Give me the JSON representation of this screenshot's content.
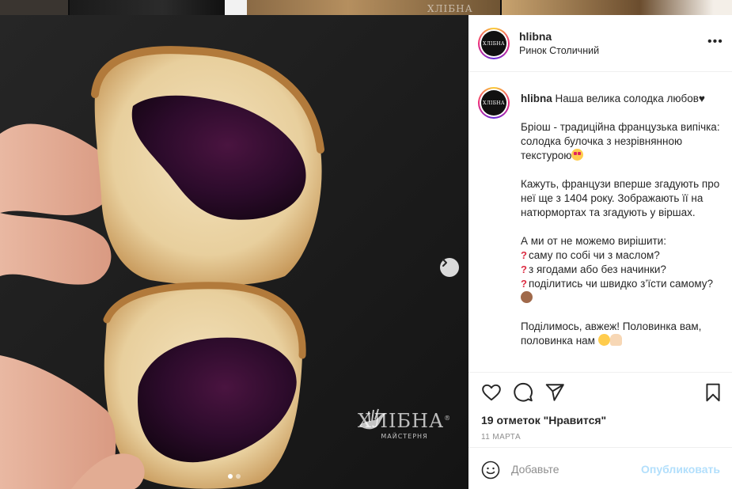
{
  "background": {
    "watermark": "ХЛІБНА"
  },
  "photo": {
    "brand_name": "ХЛІБНА",
    "brand_reg": "®",
    "brand_sub": "МАЙСТЕРНЯ",
    "carousel": {
      "slides": 2,
      "active_index": 0
    }
  },
  "post": {
    "avatar_text": "ХЛІБНА",
    "username": "hlibna",
    "location": "Ринок Столичний",
    "more_icon": "more-horizontal-icon",
    "caption": {
      "username": "hlibna",
      "title": "Наша велика солодка любов♥",
      "paragraphs": [
        "Бріош - традиційна французька випічка: солодка булочка з незрівнянною текстурою",
        "Кажуть, французи вперше згадують про неї ще з 1404 року. Зображають її на натюрмортах та згадують у віршах.",
        "А ми от не можемо вирішити:",
        "саму по собі чи з маслом?",
        "з ягодами або без начинки?",
        "поділитись чи швидко з’їсти самому?",
        "Поділимось, авжеж! Половинка вам, половинка нам"
      ]
    },
    "likes": "19 отметок \"Нравится\"",
    "date": "11 МАРТА",
    "comment_placeholder": "Добавьте",
    "publish_label": "Опубликовать",
    "colors": {
      "publish_disabled": "#b2dffc",
      "text": "#262626",
      "muted": "#8e8e8e"
    },
    "action_icons": [
      "heart-icon",
      "comment-icon",
      "share-icon",
      "bookmark-icon"
    ]
  }
}
